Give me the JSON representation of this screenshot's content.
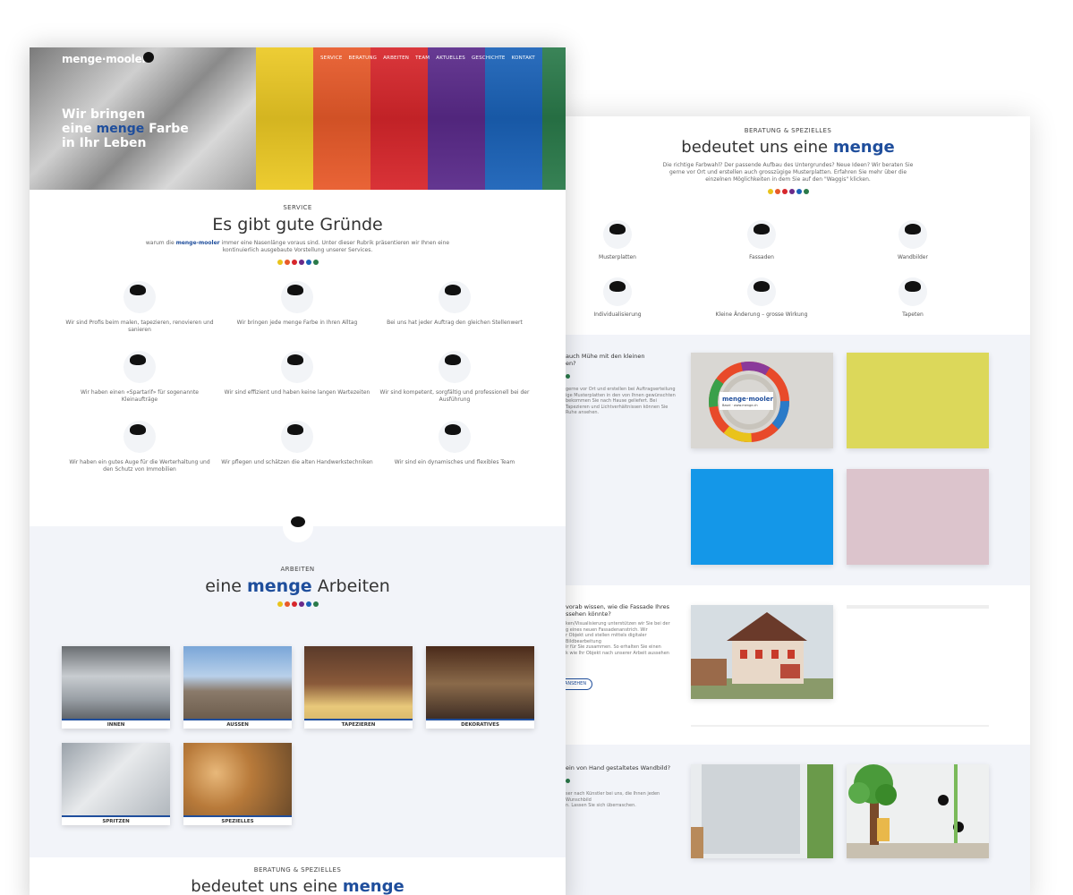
{
  "colors": {
    "accent": "#1f4e9c",
    "dots": [
      "#e9c31b",
      "#e85a2a",
      "#d7262b",
      "#6a2a8a",
      "#1a62b8",
      "#2a7a4a"
    ]
  },
  "front": {
    "logo": "menge·mooler",
    "nav": [
      "SERVICE",
      "BERATUNG",
      "ARBEITEN",
      "TEAM",
      "AKTUELLES",
      "GESCHICHTE",
      "KONTAKT"
    ],
    "hero": {
      "line1": "Wir bringen",
      "line2_pre": "eine",
      "line2_accent": "menge",
      "line2_post": "Farbe",
      "line3": "in Ihr Leben"
    },
    "service": {
      "label": "SERVICE",
      "title": "Es gibt gute Gründe",
      "intro_pre": "warum die",
      "intro_brand": "menge-mooler",
      "intro_post": "immer eine Nasenlänge voraus sind. Unter dieser Rubrik präsentieren wir Ihnen eine kontinuierlich ausgebaute Vorstellung unserer Services.",
      "items": [
        "Wir sind Profis beim malen, tapezieren, renovieren und sanieren",
        "Wir bringen jede menge Farbe in Ihren Alltag",
        "Bei uns hat jeder Auftrag den gleichen Stellenwert",
        "Wir haben einen «Spartarif» für sogenannte Kleinaufträge",
        "Wir sind effizient und haben keine langen Wartezeiten",
        "Wir sind kompetent, sorgfältig und professionell bei der Ausführung",
        "Wir haben ein gutes Auge für die Werterhaltung und den Schutz von Immobilien",
        "Wir pflegen und schätzen die alten Handwerkstechniken",
        "Wir sind ein dynamisches und flexibles Team"
      ]
    },
    "arbeiten": {
      "label": "ARBEITEN",
      "title_pre": "eine",
      "title_accent": "menge",
      "title_post": "Arbeiten",
      "items": [
        "INNEN",
        "AUSSEN",
        "TAPEZIEREN",
        "DEKORATIVES",
        "SPRITZEN",
        "SPEZIELLES"
      ]
    },
    "bottom": {
      "label": "BERATUNG & SPEZIELLES",
      "title_pre": "bedeutet uns eine",
      "title_accent": "menge"
    }
  },
  "back": {
    "label": "BERATUNG & SPEZIELLES",
    "title_pre": "bedeutet uns eine",
    "title_accent": "menge",
    "intro": "Die richtige Farbwahl? Der passende Aufbau des Untergrundes? Neue Ideen? Wir beraten Sie gerne vor Ort und erstellen auch grosszügige Musterplatten. Erfahren Sie mehr über die einzelnen Möglichkeiten in dem Sie auf den \"Waggis\" klicken.",
    "icons": [
      "Musterplatten",
      "Fassaden",
      "Wandbilder",
      "Individualisierung",
      "Kleine Änderung – grosse Wirkung",
      "Tapeten"
    ],
    "panel1": {
      "question": "auch Mühe mit den kleinen\nen?",
      "text": "gerne vor Ort und erstellen bei Auftragserteilung\nige Musterplatten in den von Ihnen gewünschten\nbekommen Sie nach Hause geliefert. Bei\nTapezieren und Lichtverhältnissen können Sie\nRuhe ansehen.",
      "fan_brand": "menge·mooler",
      "fan_city": "Basel · www.menge.ch"
    },
    "panel2": {
      "question": "vorab wissen, wie die Fassade Ihres\nssehen könnte?",
      "text": "ken/Visualisierung unterstützen wir Sie bei der\ng eines neuen Fassadenanstrich. Wir\nr Objekt und stellen mittels digitaler Bildbearbeitung\nir für Sie zusammen. So erhalten Sie einen\nk wie Ihr Objekt nach unserer Arbeit aussehen",
      "button": "ANSEHEN"
    },
    "panel3": {
      "question": "ein von Hand gestaltetes Wandbild?",
      "text": "ser nach Künstler bei uns, die Ihnen jeden Wunschbild\nn. Lassen Sie sich überraschen."
    }
  }
}
